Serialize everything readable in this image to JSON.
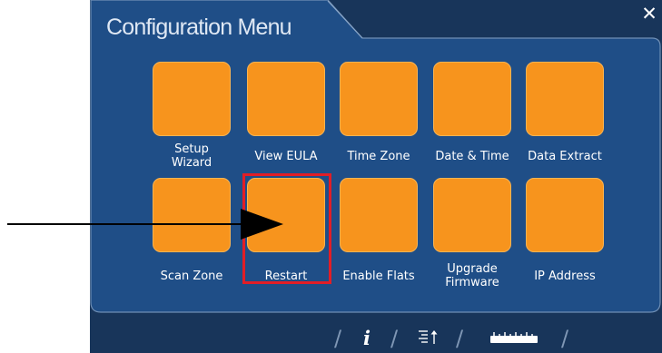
{
  "window": {
    "title": "Configuration Menu"
  },
  "tiles": [
    {
      "label": "Setup\nWizard"
    },
    {
      "label": "View EULA"
    },
    {
      "label": "Time Zone"
    },
    {
      "label": "Date & Time"
    },
    {
      "label": "Data Extract"
    },
    {
      "label": "Scan Zone"
    },
    {
      "label": "Restart"
    },
    {
      "label": "Enable Flats"
    },
    {
      "label": "Upgrade\nFirmware"
    },
    {
      "label": "IP Address"
    }
  ],
  "bottom_bar": {
    "icons": [
      "info-icon",
      "sort-list-icon",
      "ruler-icon"
    ],
    "info_glyph": "i"
  },
  "colors": {
    "panel": "#18355a",
    "frame": "#1f4e87",
    "tile": "#f7941d",
    "highlight": "#e21e26"
  }
}
